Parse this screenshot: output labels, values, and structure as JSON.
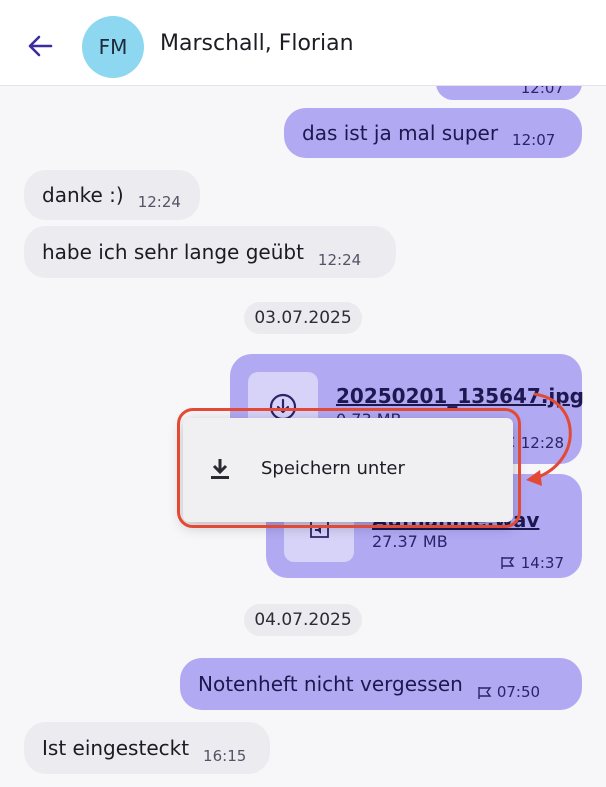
{
  "header": {
    "avatar_initials": "FM",
    "contact_name": "Marschall, Florian",
    "avatar_color": "#8dd7f0"
  },
  "messages": [
    {
      "direction": "out",
      "text": "",
      "time": "12:07"
    },
    {
      "direction": "out",
      "text": "das ist ja mal super",
      "time": "12:07"
    },
    {
      "direction": "in",
      "text": "danke :)",
      "time": "12:24"
    },
    {
      "direction": "in",
      "text": "habe ich sehr lange geübt",
      "time": "12:24"
    }
  ],
  "date_1": "03.07.2025",
  "files": [
    {
      "name": "20250201_135647.jpg",
      "size": "0.73 MB",
      "time": "12:28",
      "icon": "download-icon"
    },
    {
      "name": "Aufnahme.wav",
      "size": "27.37 MB",
      "time": "14:37",
      "icon": "audio-file-icon"
    }
  ],
  "date_2": "04.07.2025",
  "messages_2": [
    {
      "direction": "out",
      "text": "Notenheft nicht vergessen",
      "time": "07:50"
    },
    {
      "direction": "in",
      "text": "Ist eingesteckt",
      "time": "16:15"
    }
  ],
  "context_menu": {
    "items": [
      {
        "label": "Speichern unter",
        "icon": "download-icon"
      }
    ]
  },
  "colors": {
    "outgoing_bubble": "#b1a9f2",
    "incoming_bubble": "#ecebef",
    "highlight": "#e34a35",
    "accent": "#3b2d9e"
  }
}
